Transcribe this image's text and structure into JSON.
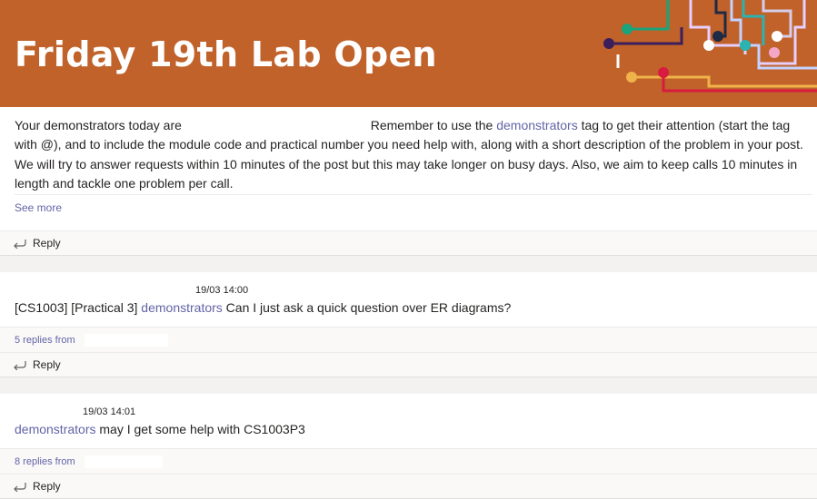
{
  "banner": {
    "title": "Friday 19th Lab Open"
  },
  "intro": {
    "part1": "Your demonstrators today are",
    "part2": "Remember to use the",
    "mention": "demonstrators",
    "part3": "tag to get their attention (start the tag with @), and to include the module code and practical number you need help with, along with a short description of the problem in your post. We will try to answer requests within 10 minutes of the post but this may take longer on busy days. Also, we aim to keep calls 10 minutes in length and tackle one problem per call.",
    "see_more": "See more"
  },
  "reply_label": "Reply",
  "threads": [
    {
      "time": "19/03 14:00",
      "prefix": "[CS1003] [Practical 3]",
      "mention": "demonstrators",
      "body": "Can I just ask a quick question over ER diagrams?",
      "replies": "5 replies from"
    },
    {
      "time": "19/03 14:01",
      "prefix": "",
      "mention": "demonstrators",
      "body": "may I get some help with CS1003P3",
      "replies": "8 replies from"
    }
  ]
}
